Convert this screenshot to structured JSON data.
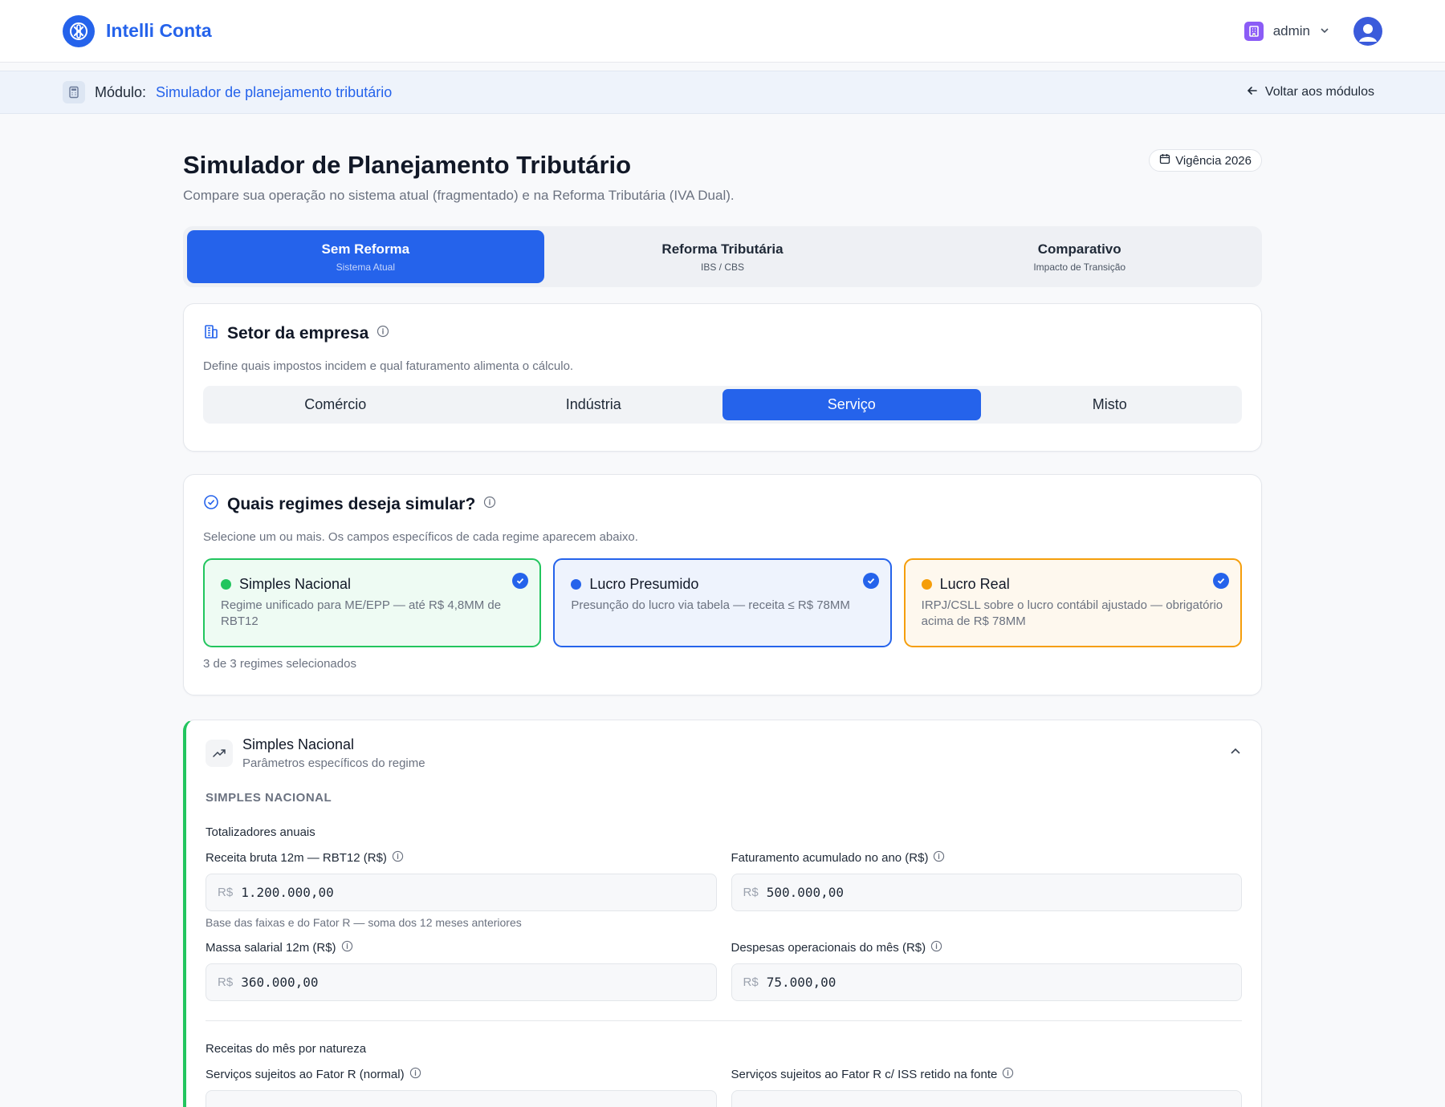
{
  "brand": {
    "name": "Intelli Conta"
  },
  "user": {
    "name": "admin"
  },
  "module": {
    "prefix": "Módulo:",
    "name": "Simulador de planejamento tributário",
    "back": "Voltar aos módulos"
  },
  "page": {
    "title": "Simulador de Planejamento Tributário",
    "subtitle": "Compare sua operação no sistema atual (fragmentado) e na Reforma Tributária (IVA Dual).",
    "vigencia": "Vigência 2026"
  },
  "tabs": [
    {
      "title": "Sem Reforma",
      "sub": "Sistema Atual"
    },
    {
      "title": "Reforma Tributária",
      "sub": "IBS / CBS"
    },
    {
      "title": "Comparativo",
      "sub": "Impacto de Transição"
    }
  ],
  "sector": {
    "title": "Setor da empresa",
    "desc": "Define quais impostos incidem e qual faturamento alimenta o cálculo.",
    "options": [
      "Comércio",
      "Indústria",
      "Serviço",
      "Misto"
    ],
    "selected": "Serviço"
  },
  "regimes": {
    "title": "Quais regimes deseja simular?",
    "desc": "Selecione um ou mais. Os campos específicos de cada regime aparecem abaixo.",
    "items": [
      {
        "title": "Simples Nacional",
        "desc": "Regime unificado para ME/EPP — até R$ 4,8MM de RBT12",
        "color": "#22c55e"
      },
      {
        "title": "Lucro Presumido",
        "desc": "Presunção do lucro via tabela — receita ≤ R$ 78MM",
        "color": "#2563eb"
      },
      {
        "title": "Lucro Real",
        "desc": "IRPJ/CSLL sobre o lucro contábil ajustado — obrigatório acima de R$ 78MM",
        "color": "#f59e0b"
      }
    ],
    "count": "3 de 3 regimes selecionados"
  },
  "params": {
    "title": "Simples Nacional",
    "sub": "Parâmetros específicos do regime",
    "section": "SIMPLES NACIONAL",
    "group1": "Totalizadores anuais",
    "currency": "R$",
    "fields": [
      {
        "label": "Receita bruta 12m — RBT12 (R$)",
        "value": "1.200.000,00",
        "hint": "Base das faixas e do Fator R — soma dos 12 meses anteriores"
      },
      {
        "label": "Faturamento acumulado no ano (R$)",
        "value": "500.000,00"
      },
      {
        "label": "Massa salarial 12m (R$)",
        "value": "360.000,00"
      },
      {
        "label": "Despesas operacionais do mês (R$)",
        "value": "75.000,00"
      }
    ],
    "group2": "Receitas do mês por natureza",
    "fields2": [
      {
        "label": "Serviços sujeitos ao Fator R (normal)"
      },
      {
        "label": "Serviços sujeitos ao Fator R c/ ISS retido na fonte"
      }
    ]
  },
  "colors": {
    "primary": "#2563eb",
    "green": "#22c55e",
    "orange": "#f59e0b"
  }
}
